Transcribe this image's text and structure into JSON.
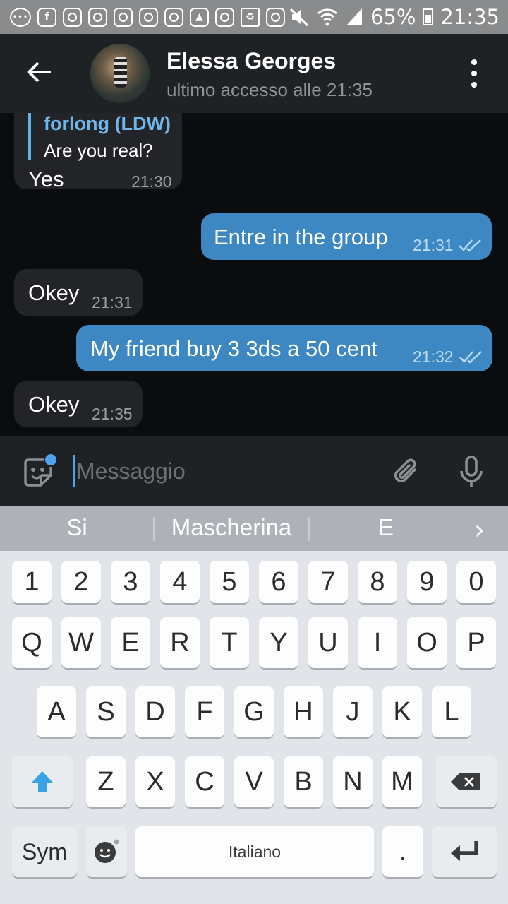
{
  "status_bar": {
    "battery": "65%",
    "time": "21:35",
    "icons": [
      "messenger-icon",
      "facebook-icon",
      "instagram-icon",
      "instagram-icon",
      "instagram-icon",
      "instagram-icon",
      "instagram-icon",
      "gallery-icon",
      "instagram-icon",
      "recycle-icon",
      "instagram-icon",
      "mute-icon",
      "wifi-icon",
      "signal-icon",
      "battery-icon"
    ]
  },
  "header": {
    "contact_name": "Elessa Georges",
    "last_seen": "ultimo accesso alle 21:35"
  },
  "messages": [
    {
      "dir": "in",
      "reply_name": "forlong (LDW)",
      "reply_text": "Are you real?",
      "text": "Yes",
      "time": "21:30"
    },
    {
      "dir": "out",
      "text": "Entre in the group",
      "time": "21:31",
      "read": true
    },
    {
      "dir": "in",
      "text": "Okey",
      "time": "21:31"
    },
    {
      "dir": "out",
      "text": "My friend buy 3 3ds a 50 cent",
      "time": "21:32",
      "read": true
    },
    {
      "dir": "in",
      "text": "Okey",
      "time": "21:35"
    }
  ],
  "composer": {
    "placeholder": "Messaggio"
  },
  "suggestions": [
    "Si",
    "Mascherina",
    "E"
  ],
  "keyboard": {
    "numbers": [
      "1",
      "2",
      "3",
      "4",
      "5",
      "6",
      "7",
      "8",
      "9",
      "0"
    ],
    "row1": [
      "Q",
      "W",
      "E",
      "R",
      "T",
      "Y",
      "U",
      "I",
      "O",
      "P"
    ],
    "row2": [
      "A",
      "S",
      "D",
      "F",
      "G",
      "H",
      "J",
      "K",
      "L"
    ],
    "row3": [
      "Z",
      "X",
      "C",
      "V",
      "B",
      "N",
      "M"
    ],
    "sym_label": "Sym",
    "space_label": "Italiano",
    "period": "."
  },
  "colors": {
    "outgoing": "#3d87c2",
    "incoming": "#222427",
    "accent": "#4ea4ea"
  }
}
